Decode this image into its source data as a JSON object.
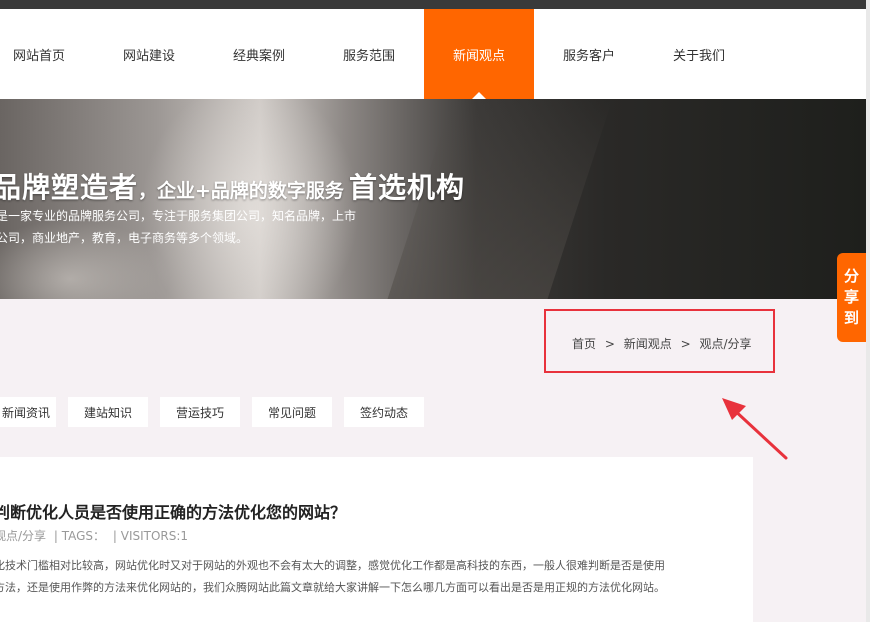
{
  "nav": {
    "items": [
      {
        "label": "网站首页"
      },
      {
        "label": "网站建设"
      },
      {
        "label": "经典案例"
      },
      {
        "label": "服务范围"
      },
      {
        "label": "新闻观点",
        "active": true
      },
      {
        "label": "服务客户"
      },
      {
        "label": "关于我们"
      }
    ],
    "active_color": "#ff6600"
  },
  "banner": {
    "headline_big": "品牌塑造者",
    "headline_mid": "，企业+品牌的数字服务",
    "headline_end": "首选机构",
    "line2": "是一家专业的品牌服务公司，专注于服务集团公司，知名品牌，上市",
    "line3": "公司，商业地产，教育，电子商务等多个领域。"
  },
  "share_tab": {
    "chars": [
      "分",
      "享",
      "到"
    ]
  },
  "breadcrumb": {
    "home": "首页",
    "sep": ">",
    "section": "新闻观点",
    "current": "观点/分享"
  },
  "categories": [
    {
      "label": "新闻资讯"
    },
    {
      "label": "建站知识"
    },
    {
      "label": "营运技巧"
    },
    {
      "label": "常见问题"
    },
    {
      "label": "签约动态"
    }
  ],
  "article": {
    "title": "判断优化人员是否使用正确的方法优化您的网站？",
    "category": "观点/分享",
    "tags": "| TAGS：",
    "visitors": "| VISITORS:1",
    "p1": "化技术门槛相对比较高，网站优化时又对于网站的外观也不会有太大的调整，感觉优化工作都是高科技的东西，一般人很难判断是否是使用",
    "p2": "方法，还是使用作弊的方法来优化网站的，我们众腾网站此篇文章就给大家讲解一下怎么哪几方面可以看出是否是用正规的方法优化网站。"
  },
  "colors": {
    "accent": "#ff6600",
    "highlight": "#e8323c"
  }
}
